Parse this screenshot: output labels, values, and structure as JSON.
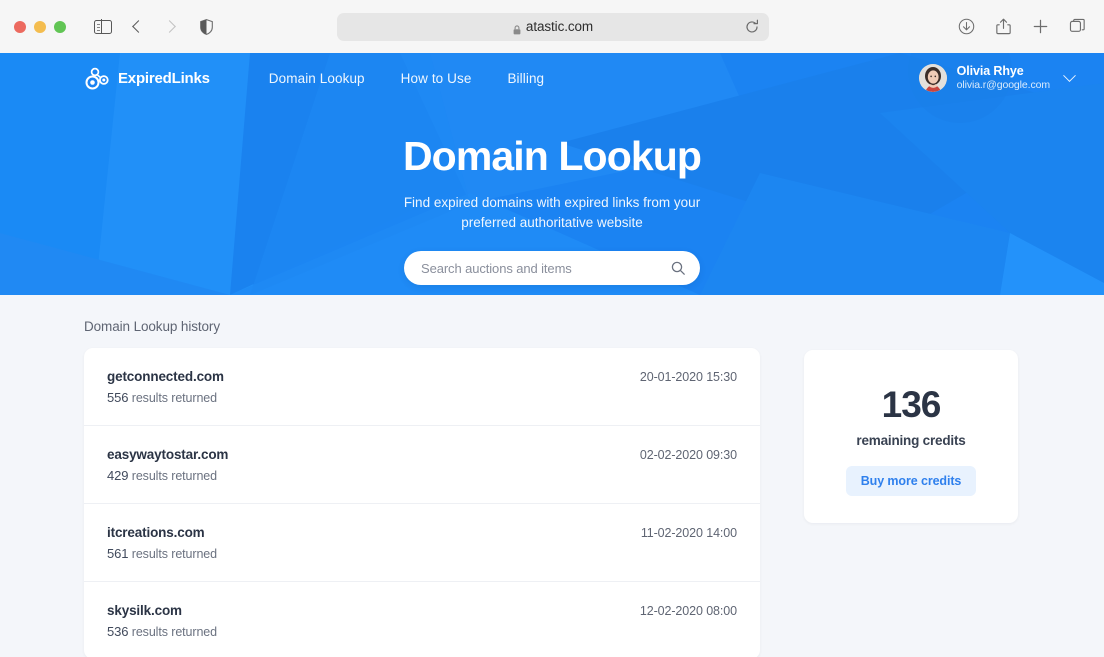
{
  "browser": {
    "url": "atastic.com",
    "lock_icon": "lock-icon",
    "shield_icon": "shield-icon",
    "reload_icon": "reload-icon",
    "sidebar_icon": "sidebar-toggle-icon",
    "back_icon": "chevron-left-icon",
    "forward_icon": "chevron-right-icon",
    "downloads_icon": "downloads-icon",
    "share_icon": "share-icon",
    "new_tab_icon": "plus-icon",
    "tab_overview_icon": "tab-overview-icon"
  },
  "header": {
    "brand": "ExpiredLinks",
    "brand_icon": "molecule-logo-icon",
    "nav": [
      {
        "label": "Domain Lookup"
      },
      {
        "label": "How to Use"
      },
      {
        "label": "Billing"
      }
    ],
    "user": {
      "name": "Olivia Rhye",
      "email": "olivia.r@google.com",
      "avatar_icon": "user-avatar-photo",
      "caret_icon": "chevron-down-icon"
    }
  },
  "hero": {
    "title": "Domain Lookup",
    "subtitle": "Find expired domains with expired links from your preferred authoritative website",
    "search": {
      "placeholder": "Search auctions and items",
      "value": "",
      "icon": "search-icon"
    },
    "background_color": "#1b83f2"
  },
  "main": {
    "history_label": "Domain Lookup history",
    "history": [
      {
        "domain": "getconnected.com",
        "count": "556",
        "results_text": "results returned",
        "date": "20-01-2020 15:30"
      },
      {
        "domain": "easywaytostar.com",
        "count": "429",
        "results_text": "results returned",
        "date": "02-02-2020 09:30"
      },
      {
        "domain": "itcreations.com",
        "count": "561",
        "results_text": "results returned",
        "date": "11-02-2020 14:00"
      },
      {
        "domain": "skysilk.com",
        "count": "536",
        "results_text": "results returned",
        "date": "12-02-2020 08:00"
      }
    ],
    "credits": {
      "number": "136",
      "label": "remaining credits",
      "button": "Buy more credits",
      "button_color": "#2f80ed",
      "button_bg": "#e8f2fe"
    }
  }
}
